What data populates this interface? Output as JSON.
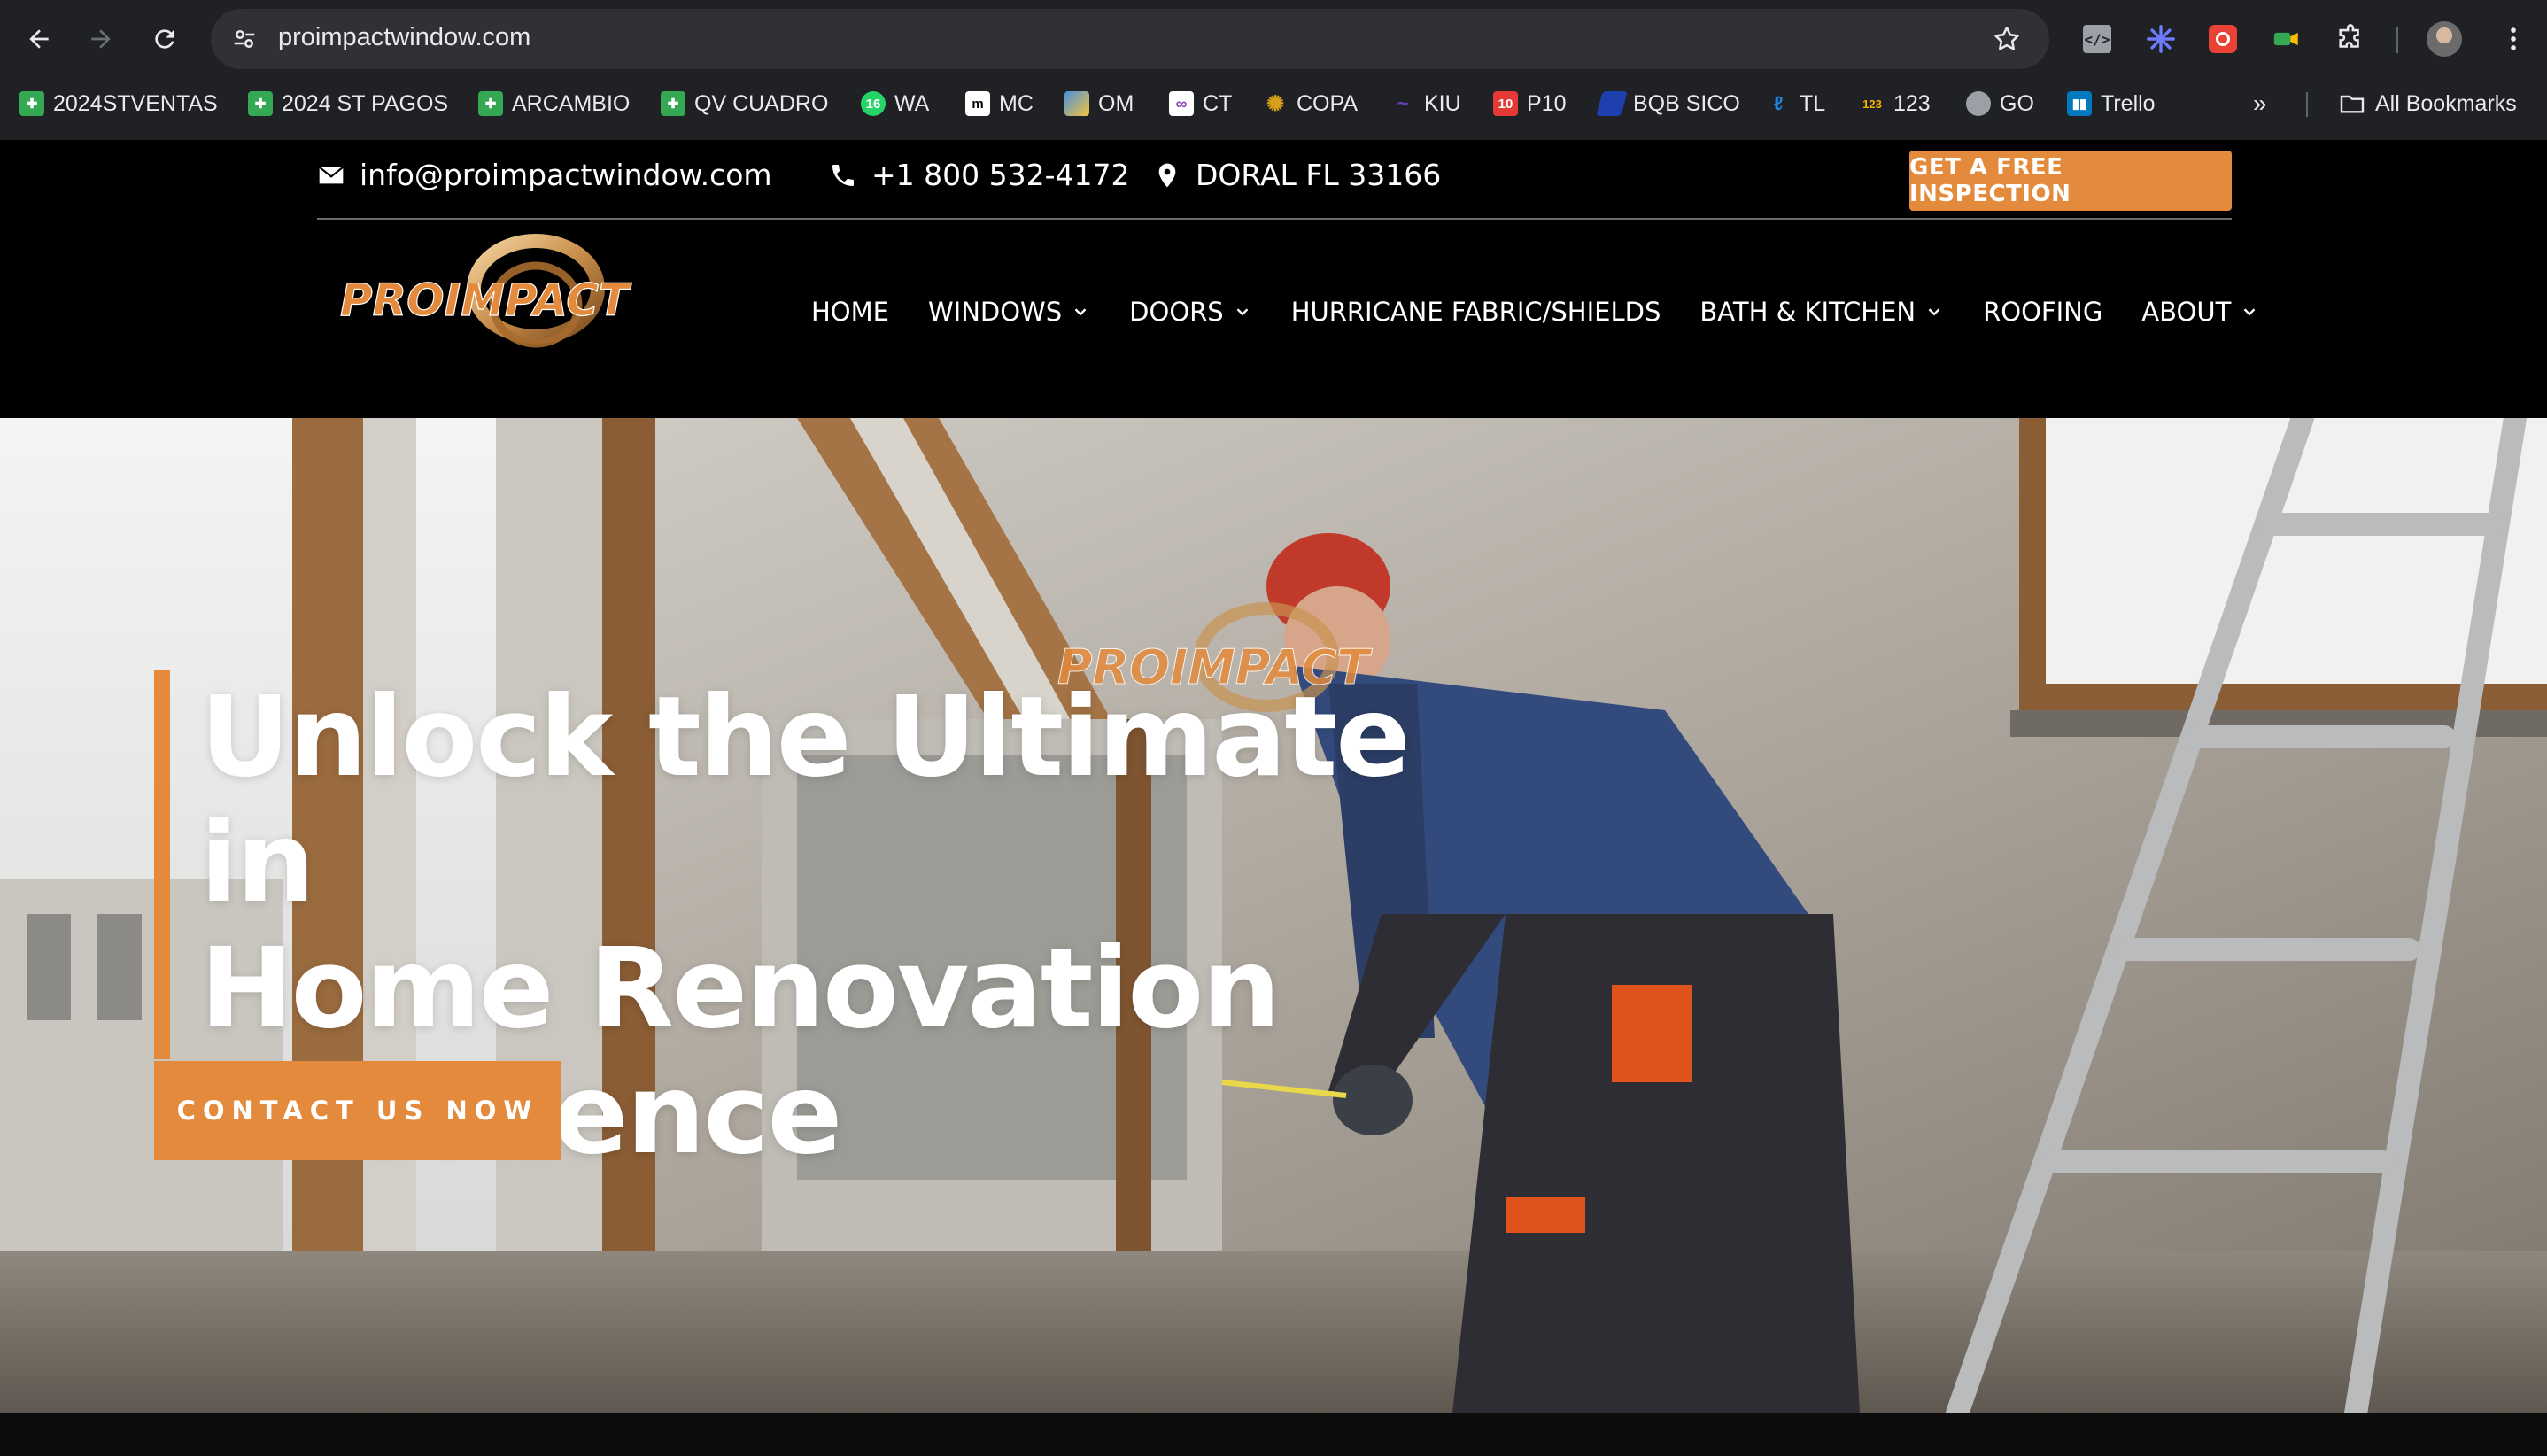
{
  "browser": {
    "url": "proimpactwindow.com",
    "bookmarks": [
      {
        "label": "2024STVENTAS",
        "icon": "sheets-icon",
        "color": "#34a853"
      },
      {
        "label": "2024 ST PAGOS",
        "icon": "sheets-icon",
        "color": "#34a853"
      },
      {
        "label": "ARCAMBIO",
        "icon": "sheets-icon",
        "color": "#34a853"
      },
      {
        "label": "QV CUADRO",
        "icon": "sheets-icon",
        "color": "#34a853"
      },
      {
        "label": "WA",
        "icon": "whatsapp-icon",
        "color": "#25d366"
      },
      {
        "label": "MC",
        "icon": "mc-icon",
        "color": "#ffffff"
      },
      {
        "label": "OM",
        "icon": "om-icon",
        "color": "#4a90d9"
      },
      {
        "label": "CT",
        "icon": "ct-icon",
        "color": "#8e44ad"
      },
      {
        "label": "COPA",
        "icon": "copa-icon",
        "color": "#d4a017"
      },
      {
        "label": "KIU",
        "icon": "kiu-icon",
        "color": "#6c3fc5"
      },
      {
        "label": "P10",
        "icon": "p10-icon",
        "color": "#e53935"
      },
      {
        "label": "BQB SICO",
        "icon": "bqb-icon",
        "color": "#1e40af"
      },
      {
        "label": "TL",
        "icon": "tl-icon",
        "color": "#1e88e5"
      },
      {
        "label": "123",
        "icon": "123-icon",
        "color": "#f4b400"
      },
      {
        "label": "GO",
        "icon": "globe-icon",
        "color": "#9aa0a6"
      },
      {
        "label": "Trello",
        "icon": "trello-icon",
        "color": "#0079bf"
      }
    ],
    "all_bookmarks": "All Bookmarks"
  },
  "header": {
    "email": "info@proimpactwindow.com",
    "phone": "+1 800 532-4172",
    "location": "DORAL FL 33166",
    "cta": "GET A FREE INSPECTION",
    "logo_text": "PROIMPACT",
    "nav": [
      {
        "label": "HOME",
        "dropdown": false
      },
      {
        "label": "WINDOWS",
        "dropdown": true
      },
      {
        "label": "DOORS",
        "dropdown": true
      },
      {
        "label": "HURRICANE FABRIC/SHIELDS",
        "dropdown": false
      },
      {
        "label": "BATH & KITCHEN",
        "dropdown": true
      },
      {
        "label": "ROOFING",
        "dropdown": false
      },
      {
        "label": "ABOUT",
        "dropdown": true
      }
    ]
  },
  "hero": {
    "title_line1": "Unlock the Ultimate in",
    "title_line2": "Home Renovation",
    "title_line3": "Excellence",
    "watermark_logo": "PROIMPACT",
    "cta": "CONTACT US NOW"
  },
  "colors": {
    "accent": "#e48a3c",
    "chrome_bg": "#202124",
    "site_bg": "#000000"
  }
}
